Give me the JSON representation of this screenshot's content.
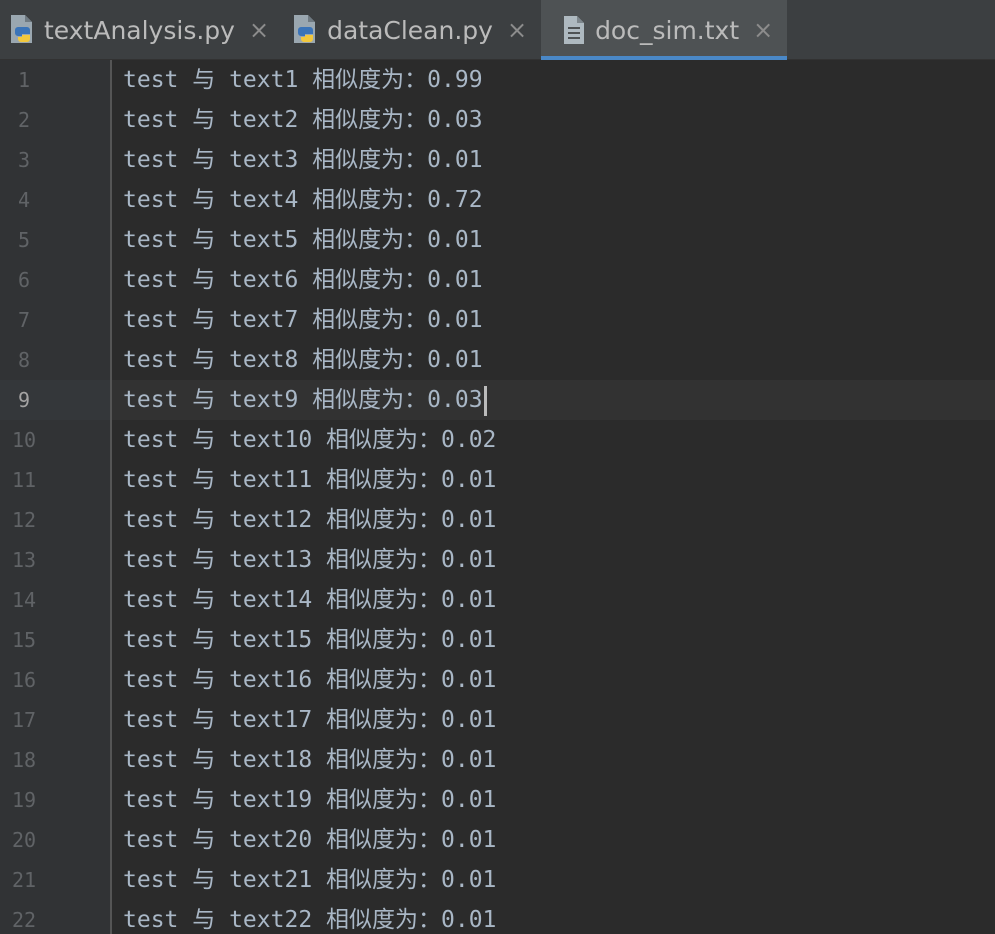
{
  "tabs": [
    {
      "label": "textAnalysis.py",
      "icon": "python-file-icon",
      "active": false
    },
    {
      "label": "dataClean.py",
      "icon": "python-file-icon",
      "active": false
    },
    {
      "label": "doc_sim.txt",
      "icon": "text-file-icon",
      "active": true
    }
  ],
  "tab_close_glyph": "×",
  "editor": {
    "current_line": 9,
    "lines": [
      {
        "n": "1",
        "text": "test 与 text1 相似度为：0.99"
      },
      {
        "n": "2",
        "text": "test 与 text2 相似度为：0.03"
      },
      {
        "n": "3",
        "text": "test 与 text3 相似度为：0.01"
      },
      {
        "n": "4",
        "text": "test 与 text4 相似度为：0.72"
      },
      {
        "n": "5",
        "text": "test 与 text5 相似度为：0.01"
      },
      {
        "n": "6",
        "text": "test 与 text6 相似度为：0.01"
      },
      {
        "n": "7",
        "text": "test 与 text7 相似度为：0.01"
      },
      {
        "n": "8",
        "text": "test 与 text8 相似度为：0.01"
      },
      {
        "n": "9",
        "text": "test 与 text9 相似度为：0.03"
      },
      {
        "n": "10",
        "text": "test 与 text10 相似度为：0.02"
      },
      {
        "n": "11",
        "text": "test 与 text11 相似度为：0.01"
      },
      {
        "n": "12",
        "text": "test 与 text12 相似度为：0.01"
      },
      {
        "n": "13",
        "text": "test 与 text13 相似度为：0.01"
      },
      {
        "n": "14",
        "text": "test 与 text14 相似度为：0.01"
      },
      {
        "n": "15",
        "text": "test 与 text15 相似度为：0.01"
      },
      {
        "n": "16",
        "text": "test 与 text16 相似度为：0.01"
      },
      {
        "n": "17",
        "text": "test 与 text17 相似度为：0.01"
      },
      {
        "n": "18",
        "text": "test 与 text18 相似度为：0.01"
      },
      {
        "n": "19",
        "text": "test 与 text19 相似度为：0.01"
      },
      {
        "n": "20",
        "text": "test 与 text20 相似度为：0.01"
      },
      {
        "n": "21",
        "text": "test 与 text21 相似度为：0.01"
      },
      {
        "n": "22",
        "text": "test 与 text22 相似度为：0.01"
      }
    ]
  },
  "colors": {
    "background": "#2b2b2b",
    "gutter": "#313335",
    "tabbar": "#3c3f41",
    "active_tab": "#4e5254",
    "active_tab_underline": "#4a88c7",
    "text": "#a9b7c6",
    "line_number": "#606366"
  }
}
